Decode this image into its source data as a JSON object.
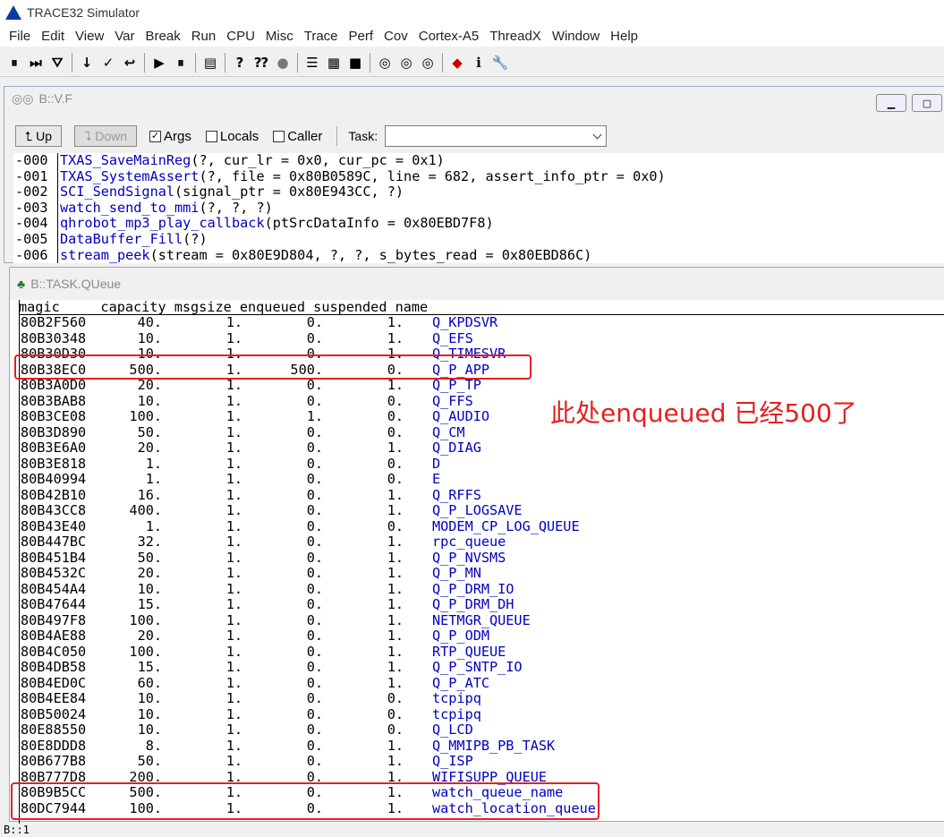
{
  "app": {
    "title": "TRACE32 Simulator"
  },
  "menu": [
    "File",
    "Edit",
    "View",
    "Var",
    "Break",
    "Run",
    "CPU",
    "Misc",
    "Trace",
    "Perf",
    "Cov",
    "Cortex-A5",
    "ThreadX",
    "Window",
    "Help"
  ],
  "vf": {
    "title": "B::V.F",
    "up": "Up",
    "down": "Down",
    "args": "Args",
    "locals": "Locals",
    "caller": "Caller",
    "task": "Task:",
    "frames": [
      {
        "lvl": "-000",
        "fn": "TXAS_SaveMainReg",
        "args": "(?, cur_lr = 0x0, cur_pc = 0x1)"
      },
      {
        "lvl": "-001",
        "fn": "TXAS_SystemAssert",
        "args": "(?, file = 0x80B0589C, line = 682, assert_info_ptr = 0x0)"
      },
      {
        "lvl": "-002",
        "fn": "SCI_SendSignal",
        "args": "(signal_ptr = 0x80E943CC, ?)"
      },
      {
        "lvl": "-003",
        "fn": "watch_send_to_mmi",
        "args": "(?, ?, ?)"
      },
      {
        "lvl": "-004",
        "fn": "qhrobot_mp3_play_callback",
        "args": "(ptSrcDataInfo = 0x80EBD7F8)"
      },
      {
        "lvl": "-005",
        "fn": "DataBuffer_Fill",
        "args": "(?)"
      },
      {
        "lvl": "-006",
        "fn": "stream_peek",
        "args": "(stream = 0x80E9D804, ?, ?, s_bytes_read = 0x80EBD86C)"
      }
    ]
  },
  "tq": {
    "title": "B::TASK.QUeue",
    "header": "magic     capacity msgsize enqueued suspended name",
    "rows": [
      [
        "80B2F560",
        "40.",
        "1.",
        "0.",
        "1.",
        "Q_KPDSVR"
      ],
      [
        "80B30348",
        "10.",
        "1.",
        "0.",
        "1.",
        "Q_EFS"
      ],
      [
        "80B30D30",
        "10.",
        "1.",
        "0.",
        "1.",
        "Q_TIMESVR"
      ],
      [
        "80B38EC0",
        "500.",
        "1.",
        "500.",
        "0.",
        "Q_P_APP"
      ],
      [
        "80B3A0D0",
        "20.",
        "1.",
        "0.",
        "1.",
        "Q_P_TP"
      ],
      [
        "80B3BAB8",
        "10.",
        "1.",
        "0.",
        "0.",
        "Q_FFS"
      ],
      [
        "80B3CE08",
        "100.",
        "1.",
        "1.",
        "0.",
        "Q_AUDIO"
      ],
      [
        "80B3D890",
        "50.",
        "1.",
        "0.",
        "0.",
        "Q_CM"
      ],
      [
        "80B3E6A0",
        "20.",
        "1.",
        "0.",
        "1.",
        "Q_DIAG"
      ],
      [
        "80B3E818",
        "1.",
        "1.",
        "0.",
        "0.",
        "D"
      ],
      [
        "80B40994",
        "1.",
        "1.",
        "0.",
        "0.",
        "E"
      ],
      [
        "80B42B10",
        "16.",
        "1.",
        "0.",
        "1.",
        "Q_RFFS"
      ],
      [
        "80B43CC8",
        "400.",
        "1.",
        "0.",
        "1.",
        "Q_P_LOGSAVE"
      ],
      [
        "80B43E40",
        "1.",
        "1.",
        "0.",
        "0.",
        "MODEM_CP_LOG_QUEUE"
      ],
      [
        "80B447BC",
        "32.",
        "1.",
        "0.",
        "1.",
        "rpc_queue"
      ],
      [
        "80B451B4",
        "50.",
        "1.",
        "0.",
        "1.",
        "Q_P_NVSMS"
      ],
      [
        "80B4532C",
        "20.",
        "1.",
        "0.",
        "1.",
        "Q_P_MN"
      ],
      [
        "80B454A4",
        "10.",
        "1.",
        "0.",
        "1.",
        "Q_P_DRM_IO"
      ],
      [
        "80B47644",
        "15.",
        "1.",
        "0.",
        "1.",
        "Q_P_DRM_DH"
      ],
      [
        "80B497F8",
        "100.",
        "1.",
        "0.",
        "1.",
        "NETMGR_QUEUE"
      ],
      [
        "80B4AE88",
        "20.",
        "1.",
        "0.",
        "1.",
        "Q_P_ODM"
      ],
      [
        "80B4C050",
        "100.",
        "1.",
        "0.",
        "1.",
        "RTP_QUEUE"
      ],
      [
        "80B4DB58",
        "15.",
        "1.",
        "0.",
        "1.",
        "Q_P_SNTP_IO"
      ],
      [
        "80B4ED0C",
        "60.",
        "1.",
        "0.",
        "1.",
        "Q_P_ATC"
      ],
      [
        "80B4EE84",
        "10.",
        "1.",
        "0.",
        "0.",
        "tcpipq"
      ],
      [
        "80B50024",
        "10.",
        "1.",
        "0.",
        "0.",
        "tcpipq"
      ],
      [
        "80E88550",
        "10.",
        "1.",
        "0.",
        "0.",
        "Q_LCD"
      ],
      [
        "80E8DDD8",
        "8.",
        "1.",
        "0.",
        "1.",
        "Q_MMIPB_PB_TASK"
      ],
      [
        "80B677B8",
        "50.",
        "1.",
        "0.",
        "1.",
        "Q_ISP"
      ],
      [
        "80B777D8",
        "200.",
        "1.",
        "0.",
        "1.",
        "WIFISUPP_QUEUE"
      ],
      [
        "80B9B5CC",
        "500.",
        "1.",
        "0.",
        "1.",
        "watch_queue_name"
      ],
      [
        "80DC7944",
        "100.",
        "1.",
        "0.",
        "1.",
        "watch_location_queue"
      ]
    ]
  },
  "annotation": "此处enqueued 已经500了",
  "status": "B::1",
  "colors": {
    "highlight": "#e52020",
    "name": "#0000c0"
  }
}
